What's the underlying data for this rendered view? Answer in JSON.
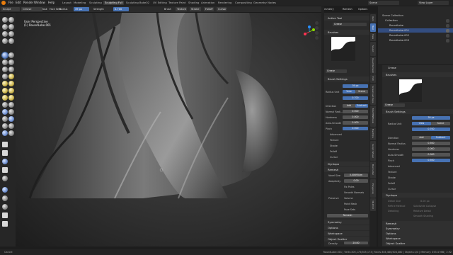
{
  "menu": {
    "items": [
      "File",
      "Edit",
      "Render",
      "Window",
      "Help"
    ]
  },
  "workspaces": [
    "Layout",
    "Modeling",
    "Sculpting",
    "Sculpting Full",
    "Sculpting Bake02",
    "UV Editing",
    "Texture Paint",
    "Shading",
    "Animation",
    "Rendering",
    "Compositing",
    "Geometry Nodes"
  ],
  "scene": {
    "label": "Scene",
    "view_layer": "View Layer"
  },
  "viewport_header": {
    "mode": "Sculpt Mode",
    "view": "View",
    "sculpt": "Sculpt",
    "mask": "Mask",
    "face_sets": "Face Sets"
  },
  "tool_header": {
    "brush": "Crease",
    "radius_label": "Radius",
    "radius": "39 px",
    "strength_label": "Strength",
    "strength": "0.700",
    "brush_menu": "Brush",
    "texture": "Texture",
    "stroke": "Stroke",
    "falloff": "Falloff",
    "cursor": "Cursor",
    "symmetry": "Symmetry",
    "remesh": "Remesh",
    "options": "Options"
  },
  "viewport": {
    "perspective": "User Perspective",
    "object": "(1) RoundLobe.001"
  },
  "npanel": {
    "active_tool": "Active Tool",
    "tool_name": "Crease",
    "brushes": "Brushes",
    "brush_name": "Crease",
    "brush_settings": "Brush Settings",
    "radius": "39 px",
    "radius_unit": "Radius Unit",
    "view": "View",
    "scene": "Scene",
    "strength": "0.700",
    "direction": "Direction",
    "add": "Add",
    "subtract": "Subtract",
    "normal_radius": "Normal Radi...",
    "normal_radius_val": "0.500",
    "hardness": "Hardness",
    "hardness_val": "0.000",
    "autosmooth": "Auto-Smooth",
    "autosmooth_val": "0.000",
    "pinch": "Pinch",
    "pinch_val": "0.500",
    "advanced": "Advanced",
    "texture": "Texture",
    "stroke": "Stroke",
    "falloff": "Falloff",
    "cursor": "Cursor",
    "dyntopo": "Dyntopo",
    "remesh": "Remesh",
    "voxel_size": "Voxel Size",
    "voxel_val": "0.006954m",
    "adaptivity": "Adaptivity",
    "adaptivity_val": "0.00",
    "fix_poles": "Fix Poles",
    "smooth_normals": "Smooth Normals",
    "preserve": "Preserve",
    "volume": "Volume",
    "paint_mask": "Paint Mask",
    "face_sets": "Face Sets",
    "remesh_btn": "Remesh",
    "symmetry": "Symmetry",
    "options": "Options",
    "workspace": "Workspace",
    "object_scatter": "Object Scatter",
    "density": "Density",
    "density_val": "20.00",
    "scale": "Scale",
    "scale_val": "0.20"
  },
  "right_tabs": [
    "Item",
    "Tool",
    "View",
    "Sculpt",
    "Quad Remesh",
    "Edit",
    "Screencast Keys",
    "MACHINEtools",
    "HardOps",
    "Sculpt Wheel",
    "BoxCutter",
    "Polygoniq",
    "3D-Print"
  ],
  "outliner": {
    "title": "Scene Collection",
    "rows": [
      {
        "name": "Collection",
        "selected": false
      },
      {
        "name": "RoundLobe",
        "selected": false
      },
      {
        "name": "RoundLobe.001",
        "selected": true
      },
      {
        "name": "RoundLobe.002",
        "selected": false
      },
      {
        "name": "RoundLobe.003",
        "selected": false
      }
    ]
  },
  "properties": {
    "object": "Crease",
    "brushes": "Brushes",
    "brush_name": "Crease",
    "brush_settings": "Brush Settings",
    "radius": "39 px",
    "radius_unit": "Radius Unit",
    "view": "View",
    "scene": "Scene",
    "strength": "0.700",
    "direction": "Direction",
    "add": "Add",
    "subtract": "Subtract",
    "normal_radius": "Normal Radius",
    "normal_radius_val": "0.500",
    "hardness": "Hardness",
    "hardness_val": "0.000",
    "autosmooth": "Auto-Smooth",
    "autosmooth_val": "0.000",
    "pinch": "Pinch",
    "pinch_val": "0.500",
    "advanced": "Advanced",
    "texture": "Texture",
    "stroke": "Stroke",
    "falloff": "Falloff",
    "cursor": "Cursor",
    "dyntopo": "Dyntopo",
    "detail_size": "Detail Size",
    "detail_size_val": "8.00 px",
    "refine_method": "Refine Method",
    "refine_val": "Subdivide Collapse",
    "detailing": "Detailing",
    "detailing_val": "Relative Detail",
    "smooth_shading": "Smooth Shading",
    "remesh": "Remesh",
    "symmetry": "Symmetry",
    "options": "Options",
    "workspace": "Workspace",
    "object_scatter": "Object Scatter"
  },
  "status": {
    "left": "Cancel",
    "right": "RoundLobe.001 | Verts:305,173/305,173 | Faces:304,480/304,480 | Objects:1/4 | Memory: 353.4 MiB | 2.92"
  }
}
